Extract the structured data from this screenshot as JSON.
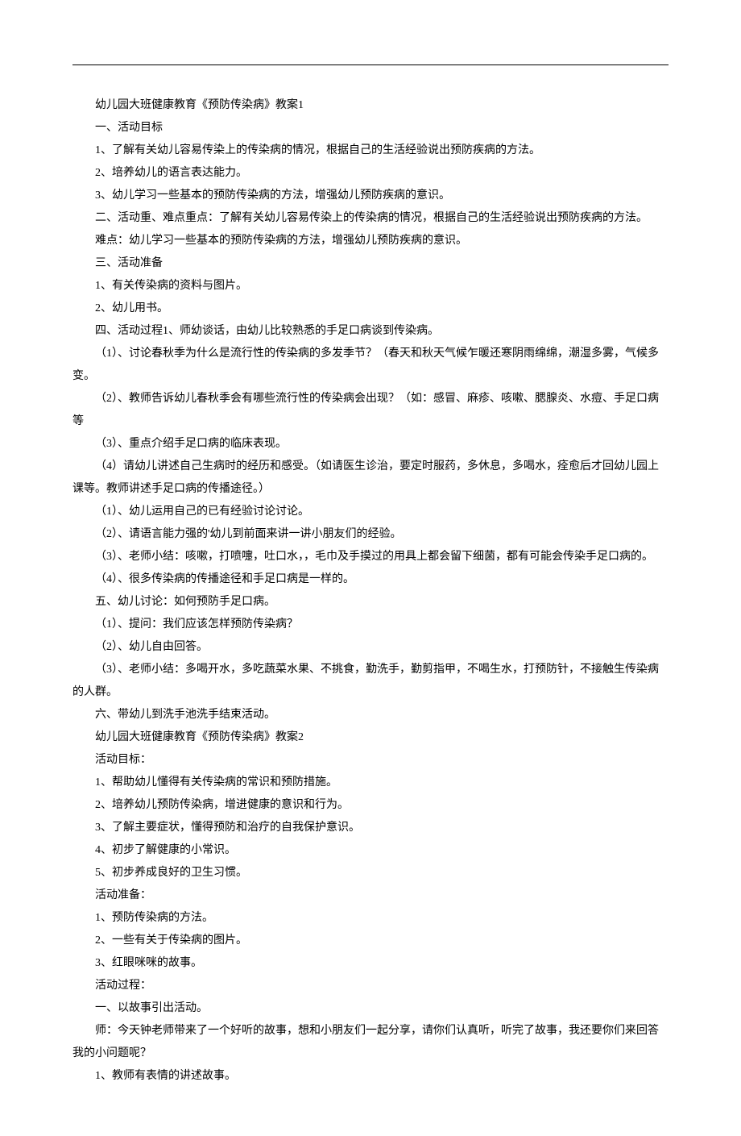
{
  "lines": [
    {
      "indent": true,
      "t": "幼儿园大班健康教育《预防传染病》教案1"
    },
    {
      "indent": true,
      "t": "一、活动目标"
    },
    {
      "indent": true,
      "t": "1、了解有关幼儿容易传染上的传染病的情况，根据自己的生活经验说出预防疾病的方法。"
    },
    {
      "indent": true,
      "t": "2、培养幼儿的语言表达能力。"
    },
    {
      "indent": true,
      "t": "3、幼儿学习一些基本的预防传染病的方法，增强幼儿预防疾病的意识。"
    },
    {
      "indent": true,
      "t": "二、活动重、难点重点：了解有关幼儿容易传染上的传染病的情况，根据自己的生活经验说出预防疾病的方法。"
    },
    {
      "indent": true,
      "t": "难点：幼儿学习一些基本的预防传染病的方法，增强幼儿预防疾病的意识。"
    },
    {
      "indent": true,
      "t": "三、活动准备"
    },
    {
      "indent": true,
      "t": "1、有关传染病的资料与图片。"
    },
    {
      "indent": true,
      "t": "2、幼儿用书。"
    },
    {
      "indent": true,
      "t": "四、活动过程1、师幼谈话，由幼儿比较熟悉的手足口病谈到传染病。"
    },
    {
      "indent": true,
      "t": "（1）、讨论春秋季为什么是流行性的传染病的多发季节？（春天和秋天气候乍暖还寒阴雨绵绵，潮湿多雾，气候多变。"
    },
    {
      "indent": true,
      "t": "（2）、教师告诉幼儿春秋季会有哪些流行性的传染病会出现？（如：感冒、麻疹、咳嗽、腮腺炎、水痘、手足口病等"
    },
    {
      "indent": true,
      "t": "（3）、重点介绍手足口病的临床表现。"
    },
    {
      "indent": true,
      "t": "（4）请幼儿讲述自己生病时的经历和感受。（如请医生诊治，要定时服药，多休息，多喝水，痊愈后才回幼儿园上课等。教师讲述手足口病的传播途径。）"
    },
    {
      "indent": true,
      "t": "（1）、幼儿运用自己的已有经验讨论讨论。"
    },
    {
      "indent": true,
      "t": "（2）、请语言能力强的'幼儿到前面来讲一讲小朋友们的经验。"
    },
    {
      "indent": true,
      "t": "（3）、老师小结：咳嗽，打喷嚏，吐口水，，毛巾及手摸过的用具上都会留下细菌，都有可能会传染手足口病的。"
    },
    {
      "indent": true,
      "t": "（4）、很多传染病的传播途径和手足口病是一样的。"
    },
    {
      "indent": true,
      "t": "五、幼儿讨论：如何预防手足口病。"
    },
    {
      "indent": true,
      "t": "（1）、提问：我们应该怎样预防传染病？"
    },
    {
      "indent": true,
      "t": "（2）、幼儿自由回答。"
    },
    {
      "indent": true,
      "t": "（3）、老师小结：多喝开水，多吃蔬菜水果、不挑食，勤洗手，勤剪指甲，不喝生水，打预防针，不接触生传染病的人群。"
    },
    {
      "indent": true,
      "t": "六、带幼儿到洗手池洗手结束活动。"
    },
    {
      "indent": true,
      "t": "幼儿园大班健康教育《预防传染病》教案2"
    },
    {
      "indent": true,
      "t": "活动目标："
    },
    {
      "indent": true,
      "t": "1、帮助幼儿懂得有关传染病的常识和预防措施。"
    },
    {
      "indent": true,
      "t": "2、培养幼儿预防传染病，增进健康的意识和行为。"
    },
    {
      "indent": true,
      "t": "3、了解主要症状，懂得预防和治疗的自我保护意识。"
    },
    {
      "indent": true,
      "t": "4、初步了解健康的小常识。"
    },
    {
      "indent": true,
      "t": "5、初步养成良好的卫生习惯。"
    },
    {
      "indent": true,
      "t": "活动准备："
    },
    {
      "indent": true,
      "t": "1、预防传染病的方法。"
    },
    {
      "indent": true,
      "t": "2、一些有关于传染病的图片。"
    },
    {
      "indent": true,
      "t": "3、红眼咪咪的故事。"
    },
    {
      "indent": true,
      "t": "活动过程："
    },
    {
      "indent": true,
      "t": "一、以故事引出活动。"
    },
    {
      "indent": true,
      "t": "师：今天钟老师带来了一个好听的故事，想和小朋友们一起分享，请你们认真听，听完了故事，我还要你们来回答我的小问题呢？"
    },
    {
      "indent": true,
      "t": "1、教师有表情的讲述故事。"
    }
  ]
}
